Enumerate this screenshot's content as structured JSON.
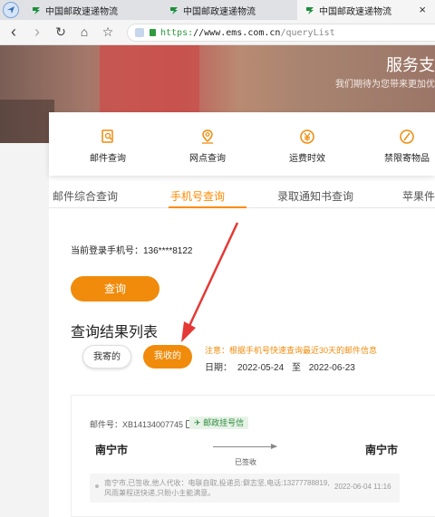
{
  "browser": {
    "tabs": [
      {
        "title": "中国邮政速递物流",
        "active": false
      },
      {
        "title": "中国邮政速递物流",
        "active": false
      },
      {
        "title": "中国邮政速递物流",
        "active": true
      }
    ],
    "close_label": "×",
    "url": {
      "scheme": "https:",
      "host": "//www.ems.com.cn",
      "path": "/queryList"
    },
    "nav": {
      "back": "‹",
      "forward": "›",
      "reload": "↻",
      "home": "⌂",
      "star": "☆"
    }
  },
  "hero": {
    "title": "服务支",
    "subtitle": "我们期待为您带来更加优"
  },
  "services": [
    {
      "label": "邮件查询",
      "icon": "search-doc-icon"
    },
    {
      "label": "网点查询",
      "icon": "location-pin-icon"
    },
    {
      "label": "运费时效",
      "icon": "yen-icon"
    },
    {
      "label": "禁限寄物品",
      "icon": "prohibited-icon"
    }
  ],
  "subtabs": [
    {
      "label": "邮件综合查询"
    },
    {
      "label": "手机号查询"
    },
    {
      "label": "录取通知书查询"
    },
    {
      "label": "苹果件查"
    }
  ],
  "login": {
    "label": "当前登录手机号：136****8122"
  },
  "query_button": "查询",
  "results": {
    "title": "查询结果列表",
    "sent_label": "我寄的",
    "received_label": "我收的",
    "notice": "注意：根据手机号快速查询最近30天的邮件信息",
    "date_label": "日期：",
    "date_from": "2022-05-24",
    "date_to_label": "至",
    "date_to": "2022-06-23"
  },
  "card": {
    "mail_no": "邮件号：XB14134007745",
    "badge": "邮政挂号信",
    "from_city": "南宁市",
    "to_city": "南宁市",
    "status": "已签收",
    "track_text": "南宁市,已签收,他人代收：电联自取,投递员:僻志坚,电话:13277788819,风雨兼程送快递,只盼小主能满意。",
    "track_time": "2022-06-04 11:16"
  },
  "colors": {
    "accent": "#f08b0b",
    "green": "#2e8b3d",
    "annotation": "#e53935"
  }
}
